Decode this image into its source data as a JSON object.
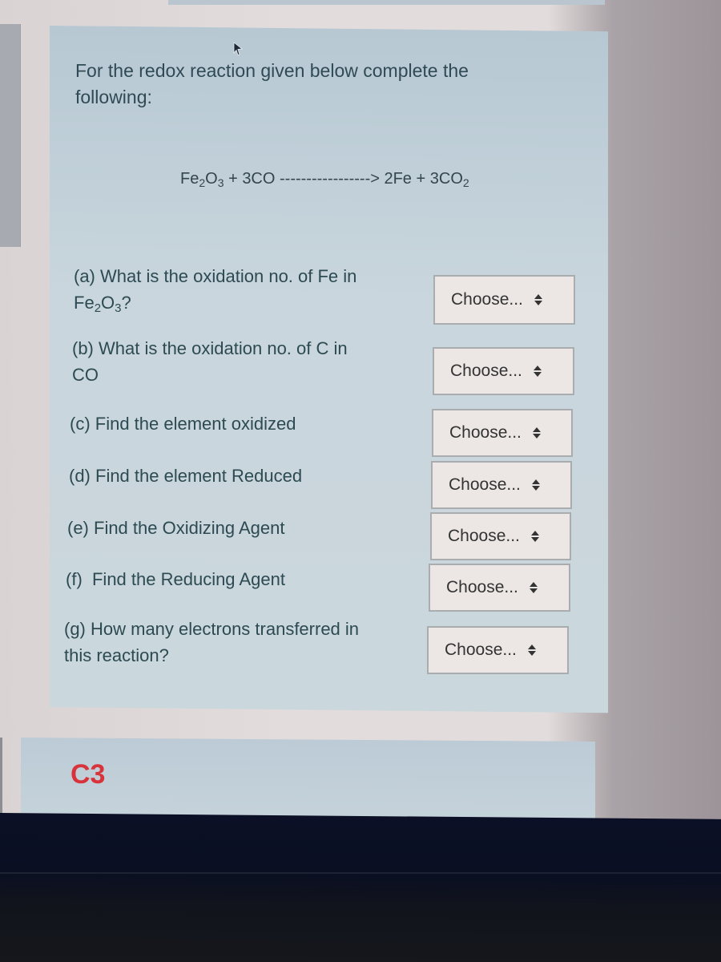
{
  "question": {
    "intro": "For the redox reaction given below complete the following:",
    "equation": {
      "reactant1": {
        "el1": "Fe",
        "sub1": "2",
        "el2": "O",
        "sub2": "3"
      },
      "plus1": "+",
      "reactant2": "3CO",
      "arrow": "-----------------> ",
      "product1": "2Fe",
      "plus2": "+",
      "product2": {
        "prefix": "3CO",
        "sub": "2"
      }
    },
    "items": [
      {
        "label_line1": "(a) What is the oxidation no. of Fe in",
        "label_line2_el1": "Fe",
        "label_line2_sub1": "2",
        "label_line2_el2": "O",
        "label_line2_sub2": "3",
        "label_line2_tail": "?",
        "select_value": "Choose..."
      },
      {
        "label_line1": "(b) What is the oxidation no. of C in",
        "label_line2": "CO",
        "select_value": "Choose..."
      },
      {
        "label": "(c) Find the element oxidized",
        "select_value": "Choose..."
      },
      {
        "label": "(d) Find the element Reduced",
        "select_value": "Choose..."
      },
      {
        "label": "(e) Find the Oxidizing Agent",
        "select_value": "Choose..."
      },
      {
        "label": "(f)  Find the Reducing Agent",
        "select_value": "Choose..."
      },
      {
        "label_line1": "(g) How many electrons transferred in",
        "label_line2": "this reaction?",
        "select_value": "Choose..."
      }
    ]
  },
  "next_section": {
    "label": "C3"
  },
  "icons": {
    "cursor": "mouse-pointer-icon",
    "select_arrow": "up-down-chevron-icon"
  },
  "colors": {
    "card_bg": "#c9d6dd",
    "text": "#2d4a52",
    "c3_label": "#d8323a"
  }
}
